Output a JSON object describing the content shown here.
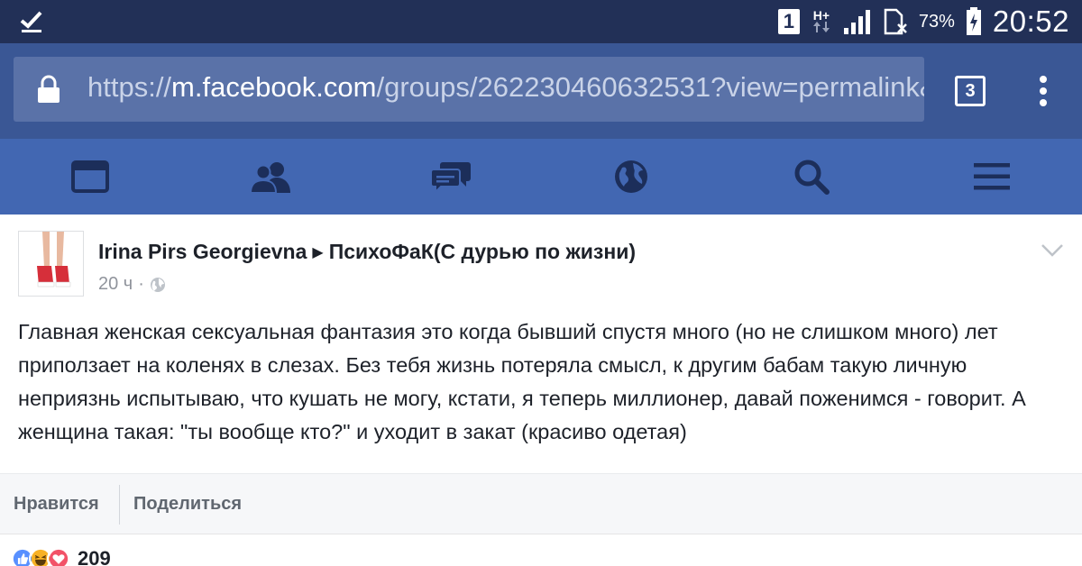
{
  "status_bar": {
    "sim_label": "1",
    "network_type": "H+",
    "battery_percent": "73%",
    "time": "20:52",
    "bg_color": "#223057"
  },
  "browser": {
    "url_scheme": "https://",
    "url_domain": "m.facebook.com",
    "url_path": "/groups/262230460632531?view=permalink&",
    "tab_count": "3",
    "accent_color": "#3a5795"
  },
  "fb_nav": {
    "items": [
      {
        "icon": "news-feed-icon"
      },
      {
        "icon": "friends-icon"
      },
      {
        "icon": "messages-icon"
      },
      {
        "icon": "globe-notifications-icon"
      },
      {
        "icon": "search-icon"
      },
      {
        "icon": "menu-icon"
      }
    ],
    "bg_color": "#4267b2"
  },
  "post": {
    "author": "Irina Pirs Georgievna",
    "arrow": "▶",
    "group": "ПсихоФаК(С дурью по жизни)",
    "time_ago": "20 ч",
    "text": "Главная женская сексуальная фантазия это когда бывший спустя много (но не слишком много) лет приползает на коленях в слезах. Без тебя жизнь потеряла смысл, к другим бабам такую личную неприязнь испытываю, что кушать не могу, кстати, я теперь миллионер, давай поженимся - говорит. А женщина такая: \"ты вообще кто?\" и уходит в закат (красиво одетая)"
  },
  "actions": {
    "like_label": "Нравится",
    "share_label": "Поделиться"
  },
  "reactions": {
    "icons": [
      "like-reaction-icon",
      "haha-reaction-icon",
      "love-reaction-icon"
    ],
    "count": "209",
    "colors": {
      "like": "#5890ff",
      "haha": "#f7b125",
      "love": "#f25268"
    }
  }
}
